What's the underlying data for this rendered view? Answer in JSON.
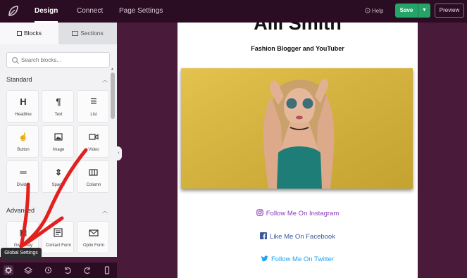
{
  "topbar": {
    "tabs": [
      "Design",
      "Connect",
      "Page Settings"
    ],
    "help_label": "Help",
    "save_label": "Save",
    "preview_label": "Preview"
  },
  "sidebar": {
    "tabs": [
      "Blocks",
      "Sections"
    ],
    "search_placeholder": "Search blocks...",
    "standard_heading": "Standard",
    "standard_blocks": [
      {
        "label": "Headline",
        "icon": "heading-icon"
      },
      {
        "label": "Text",
        "icon": "paragraph-icon"
      },
      {
        "label": "List",
        "icon": "list-icon"
      },
      {
        "label": "Button",
        "icon": "pointer-icon"
      },
      {
        "label": "Image",
        "icon": "image-icon"
      },
      {
        "label": "Video",
        "icon": "video-icon"
      },
      {
        "label": "Divider",
        "icon": "divider-icon"
      },
      {
        "label": "Spacer",
        "icon": "spacer-icon"
      },
      {
        "label": "Column",
        "icon": "columns-icon"
      }
    ],
    "advanced_heading": "Advanced",
    "advanced_blocks": [
      {
        "label": "Giveaway",
        "icon": "gift-icon"
      },
      {
        "label": "Contact Form",
        "icon": "form-icon"
      },
      {
        "label": "Optin Form",
        "icon": "mail-icon"
      }
    ]
  },
  "tooltip": "Global Settings",
  "page": {
    "title": "Alli Smith",
    "subtitle": "Fashion Blogger and YouTuber",
    "links": [
      {
        "label": "Follow Me On Instagram",
        "icon": "instagram-icon",
        "color": "#8a3ab9"
      },
      {
        "label": "Like Me On Facebook",
        "icon": "facebook-icon",
        "color": "#3b5998"
      },
      {
        "label": "Follow Me On Twitter",
        "icon": "twitter-icon",
        "color": "#1da1f2"
      }
    ]
  },
  "colors": {
    "accent": "#24a466",
    "dark": "#2a0d22",
    "background": "#4a1a3a",
    "arrow": "#e0211d"
  }
}
